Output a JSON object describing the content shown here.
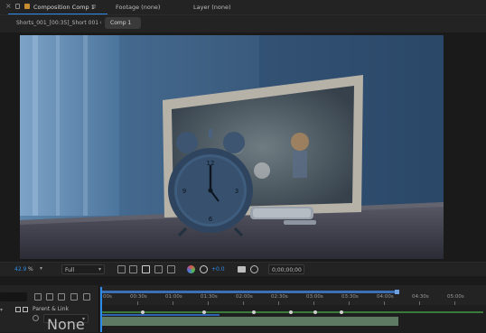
{
  "tabs": {
    "composition": "Composition Comp 1",
    "footage": "Footage (none)",
    "layer": "Layer (none)"
  },
  "breadcrumb": {
    "parent": "Shorts_001_[00:35]_Short 001",
    "current": "Comp 1"
  },
  "viewer_controls": {
    "zoom_value": "42.9",
    "zoom_unit": "%",
    "resolution": "Full",
    "exposure": "+0.0",
    "timecode": "0;00;00;00"
  },
  "timeline": {
    "column_header": "Parent & Link",
    "parent_value": "None",
    "ruler_ticks": [
      "00s",
      "00:30s",
      "01:00s",
      "01:30s",
      "02:00s",
      "02:30s",
      "03:00s",
      "03:30s",
      "04:00s",
      "04:30s",
      "05:00s"
    ]
  },
  "colors": {
    "accent": "#2d8ceb",
    "comp_icon": "#c88d2f",
    "work_area": "#3b6fb6"
  }
}
